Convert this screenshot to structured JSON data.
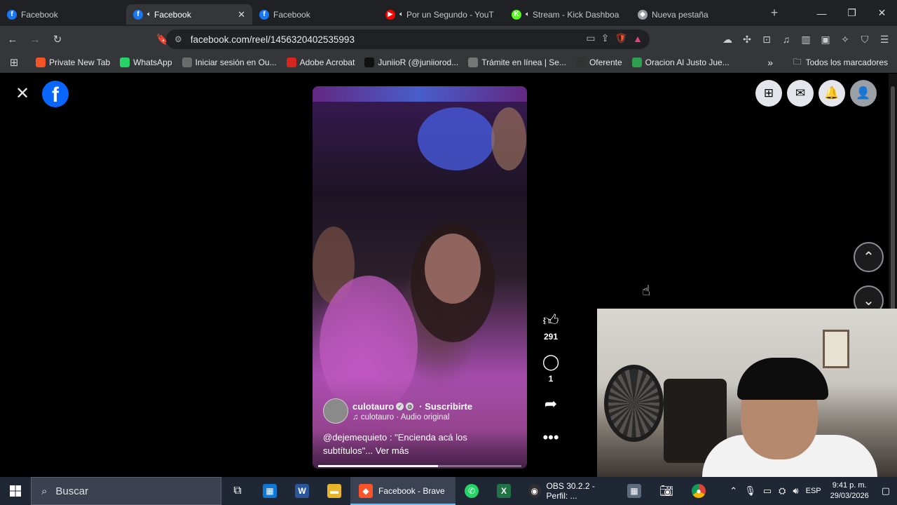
{
  "browser": {
    "tabs": [
      {
        "title": "Facebook",
        "active": false,
        "audio": false,
        "favicon": "facebook-icon",
        "color": "#1877f2"
      },
      {
        "title": "Facebook",
        "active": true,
        "audio": true,
        "favicon": "facebook-icon",
        "color": "#1877f2"
      },
      {
        "title": "Facebook",
        "active": false,
        "audio": false,
        "favicon": "facebook-icon",
        "color": "#1877f2"
      },
      {
        "title": "Por un Segundo - YouT",
        "active": false,
        "audio": true,
        "favicon": "youtube-icon",
        "color": "#ff0000"
      },
      {
        "title": "Stream - Kick Dashboa",
        "active": false,
        "audio": true,
        "favicon": "kick-icon",
        "color": "#53fc18"
      },
      {
        "title": "Nueva pestaña",
        "active": false,
        "audio": false,
        "favicon": "brave-icon",
        "color": "#9aa0a6"
      }
    ],
    "new_tab": "+",
    "url": "facebook.com/reel/1456320402535993",
    "bookmarks": [
      {
        "label": "Private New Tab",
        "color": "#f35325",
        "icon": "windows-icon"
      },
      {
        "label": "WhatsApp",
        "color": "#25d366",
        "icon": "whatsapp-icon"
      },
      {
        "label": "Iniciar sesión en Ou...",
        "color": "#6b6b6b",
        "icon": "globe-icon"
      },
      {
        "label": "Adobe Acrobat",
        "color": "#d4261e",
        "icon": "acrobat-icon"
      },
      {
        "label": "JuniioR (@juniiorod...",
        "color": "#111111",
        "icon": "tiktok-icon"
      },
      {
        "label": "Trámite en línea | Se...",
        "color": "#777777",
        "icon": "seal-icon"
      },
      {
        "label": "Oferente",
        "color": "#333333",
        "icon": "apple-icon"
      },
      {
        "label": "Oracion Al Justo Jue...",
        "color": "#2e9e4f",
        "icon": "sheets-icon"
      }
    ],
    "bookmarks_more": "»",
    "all_bookmarks": "Todos los marcadores"
  },
  "reel": {
    "username": "culotauro",
    "subscribe": "· Suscribirte",
    "audio": "culotauro · Audio original",
    "caption": "@dejemequieto : \"Encienda acá los subtítulos\"... Ver más",
    "progress": 0.59,
    "likes": "291",
    "comments": "1"
  },
  "taskbar": {
    "search_placeholder": "Buscar",
    "active_app": "Facebook - Brave",
    "obs_app": "OBS 30.2.2 - Perfil: ...",
    "lang": "ESP",
    "time": "9:41 p. m.",
    "date": "29/03/2026"
  }
}
